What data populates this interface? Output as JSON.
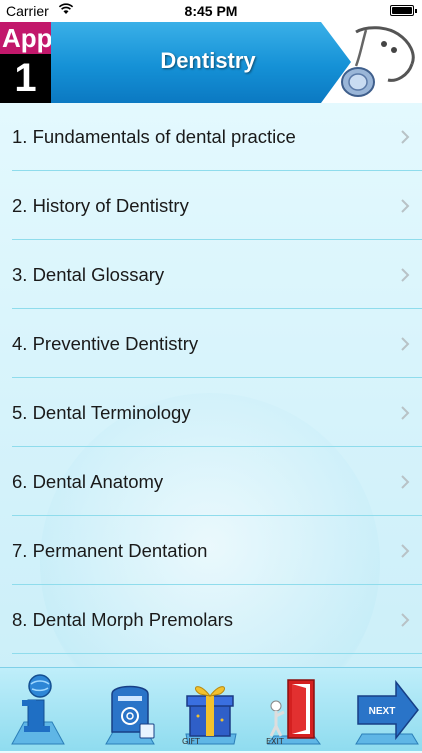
{
  "status_bar": {
    "carrier": "Carrier",
    "time": "8:45 PM"
  },
  "header": {
    "app_badge_top": "App",
    "app_badge_number": "1",
    "title": "Dentistry"
  },
  "list": {
    "items": [
      {
        "label": "1. Fundamentals of dental practice"
      },
      {
        "label": "2. History of Dentistry"
      },
      {
        "label": "3. Dental Glossary"
      },
      {
        "label": "4. Preventive Dentistry"
      },
      {
        "label": "5. Dental Terminology"
      },
      {
        "label": "6. Dental Anatomy"
      },
      {
        "label": "7. Permanent Dentation"
      },
      {
        "label": "8. Dental Morph Premolars"
      }
    ]
  },
  "toolbar": {
    "info_icon": "info-icon",
    "mail_icon": "mailbox-icon",
    "gift_icon": "gift-icon",
    "gift_caption": "GIFT",
    "exit_icon": "exit-door-icon",
    "exit_caption": "EXIT",
    "next_icon": "next-arrow-icon",
    "next_label": "NEXT"
  },
  "colors": {
    "banner_blue": "#1591d6",
    "badge_magenta": "#c2186b",
    "separator": "#8fdcec",
    "background": "#d6f3fb"
  }
}
